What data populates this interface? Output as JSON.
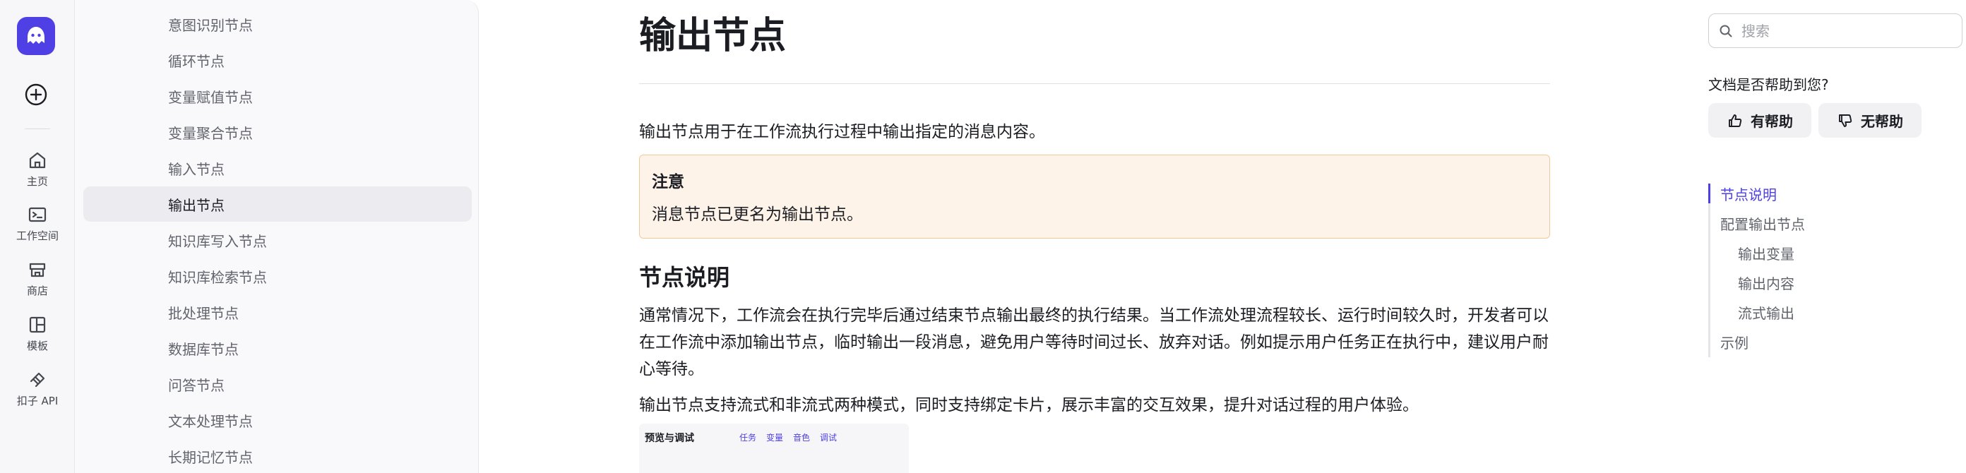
{
  "rail": {
    "items": [
      {
        "label": "主页",
        "icon": "home-icon"
      },
      {
        "label": "工作空间",
        "icon": "workspace-icon"
      },
      {
        "label": "商店",
        "icon": "store-icon"
      },
      {
        "label": "模板",
        "icon": "template-icon"
      },
      {
        "label": "扣子 API",
        "icon": "api-icon"
      }
    ]
  },
  "sidebar": {
    "items": [
      {
        "label": "意图识别节点"
      },
      {
        "label": "循环节点"
      },
      {
        "label": "变量赋值节点"
      },
      {
        "label": "变量聚合节点"
      },
      {
        "label": "输入节点"
      },
      {
        "label": "输出节点",
        "active": true
      },
      {
        "label": "知识库写入节点"
      },
      {
        "label": "知识库检索节点"
      },
      {
        "label": "批处理节点"
      },
      {
        "label": "数据库节点"
      },
      {
        "label": "问答节点"
      },
      {
        "label": "文本处理节点"
      },
      {
        "label": "长期记忆节点"
      }
    ]
  },
  "main": {
    "title": "输出节点",
    "intro": "输出节点用于在工作流执行过程中输出指定的消息内容。",
    "note": {
      "title": "注意",
      "text": "消息节点已更名为输出节点。"
    },
    "section_title": "节点说明",
    "para1": "通常情况下，工作流会在执行完毕后通过结束节点输出最终的执行结果。当工作流处理流程较长、运行时间较久时，开发者可以在工作流中添加输出节点，临时输出一段消息，避免用户等待时间过长、放弃对话。例如提示用户任务正在执行中，建议用户耐心等待。",
    "para2": "输出节点支持流式和非流式两种模式，同时支持绑定卡片，展示丰富的交互效果，提升对话过程的用户体验。",
    "preview": {
      "title": "预览与调试",
      "tools": [
        "任务",
        "变量",
        "音色",
        "调试"
      ]
    }
  },
  "right": {
    "search_placeholder": "搜索",
    "help_question": "文档是否帮助到您?",
    "helpful": "有帮助",
    "not_helpful": "无帮助",
    "toc": [
      {
        "label": "节点说明",
        "level": 1,
        "active": true
      },
      {
        "label": "配置输出节点",
        "level": 1
      },
      {
        "label": "输出变量",
        "level": 2
      },
      {
        "label": "输出内容",
        "level": 2
      },
      {
        "label": "流式输出",
        "level": 2
      },
      {
        "label": "示例",
        "level": 1
      }
    ]
  },
  "colors": {
    "accent": "#4e40e5",
    "note_bg": "#fdf3e8",
    "note_border": "#f5c89a"
  }
}
